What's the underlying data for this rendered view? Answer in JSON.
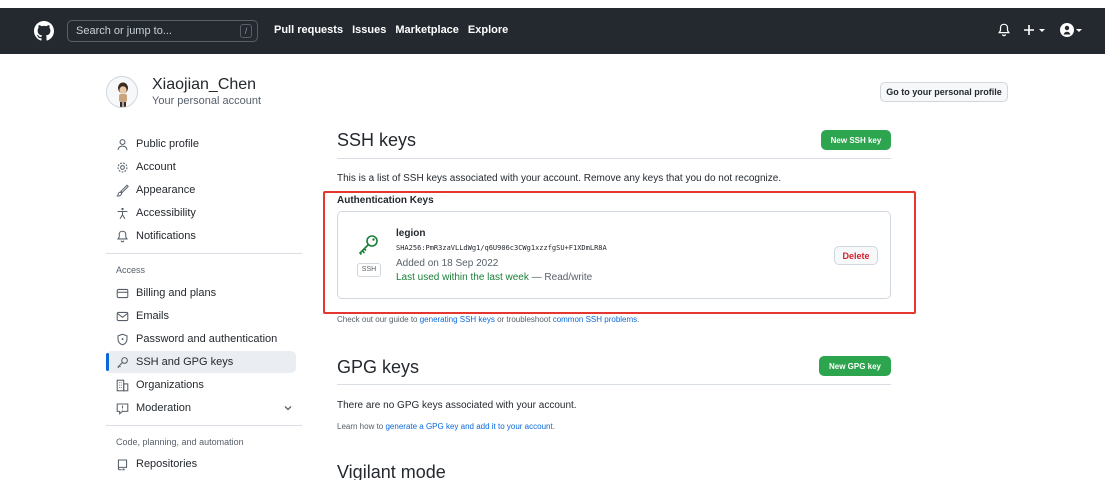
{
  "header": {
    "search_placeholder": "Search or jump to...",
    "search_shortcut": "/",
    "nav": [
      "Pull requests",
      "Issues",
      "Marketplace",
      "Explore"
    ]
  },
  "account": {
    "name": "Xiaojian_Chen",
    "subtitle": "Your personal account",
    "profile_button": "Go to your personal profile"
  },
  "sidebar": {
    "items": [
      {
        "label": "Public profile",
        "icon": "person-icon"
      },
      {
        "label": "Account",
        "icon": "gear-icon"
      },
      {
        "label": "Appearance",
        "icon": "paintbrush-icon"
      },
      {
        "label": "Accessibility",
        "icon": "accessibility-icon"
      },
      {
        "label": "Notifications",
        "icon": "bell-icon"
      }
    ],
    "access_heading": "Access",
    "access_items": [
      {
        "label": "Billing and plans",
        "icon": "credit-card-icon"
      },
      {
        "label": "Emails",
        "icon": "mail-icon"
      },
      {
        "label": "Password and authentication",
        "icon": "shield-lock-icon"
      },
      {
        "label": "SSH and GPG keys",
        "icon": "key-icon",
        "active": true
      },
      {
        "label": "Organizations",
        "icon": "organization-icon"
      },
      {
        "label": "Moderation",
        "icon": "report-icon"
      }
    ],
    "code_heading": "Code, planning, and automation",
    "code_items": [
      {
        "label": "Repositories",
        "icon": "repo-icon"
      }
    ]
  },
  "ssh": {
    "title": "SSH keys",
    "new_button": "New SSH key",
    "description": "This is a list of SSH keys associated with your account. Remove any keys that you do not recognize.",
    "auth_heading": "Authentication Keys",
    "key": {
      "name": "legion",
      "badge": "SSH",
      "fingerprint": "SHA256:PmR3zaVLLdWg1/q6U906c3CWg1xzzfgSU+F1XDmLR8A",
      "added": "Added on 18 Sep 2022",
      "last_used": "Last used within the last week",
      "access": "— Read/write",
      "delete_button": "Delete"
    },
    "help_prefix": "Check out our guide to ",
    "help_link1": "generating SSH keys",
    "help_middle": " or troubleshoot ",
    "help_link2": "common SSH problems",
    "help_suffix": "."
  },
  "gpg": {
    "title": "GPG keys",
    "new_button": "New GPG key",
    "description": "There are no GPG keys associated with your account.",
    "help_prefix": "Learn how to ",
    "help_link": "generate a GPG key and add it to your account",
    "help_suffix": "."
  },
  "vigilant": {
    "title": "Vigilant mode"
  },
  "colors": {
    "header_bg": "#24292f",
    "green": "#2da44e",
    "link": "#0969da",
    "danger": "#cf222e",
    "highlight_box": "#e5362f"
  }
}
